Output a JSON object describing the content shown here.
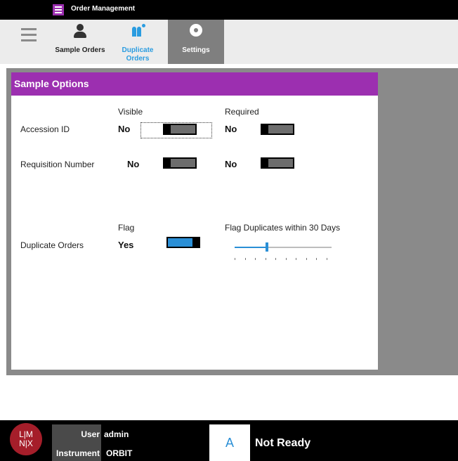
{
  "app": {
    "title": "Order Management"
  },
  "toolbar": {
    "sample_orders": "Sample Orders",
    "duplicate_orders": "Duplicate Orders",
    "settings": "Settings"
  },
  "panel": {
    "title": "Sample Options",
    "col_visible": "Visible",
    "col_required": "Required",
    "rows": [
      {
        "label": "Accession ID",
        "visible": "No",
        "required": "No"
      },
      {
        "label": "Requisition Number",
        "visible": "No",
        "required": "No"
      }
    ],
    "duplicate": {
      "label": "Duplicate Orders",
      "flag_header": "Flag",
      "flag_value": "Yes",
      "slider_label": "Flag Duplicates within 30 Days",
      "slider_fraction": 0.33
    }
  },
  "status": {
    "user_label": "User",
    "user_value": "admin",
    "instrument_label": "Instrument",
    "instrument_value": "ORBIT",
    "state_letter": "A",
    "state_text": "Not Ready"
  },
  "logo": {
    "top": "L|M",
    "bottom": "N|X"
  },
  "colors": {
    "accent": "#9c2fb0",
    "blue": "#2a8fd6",
    "logo": "#a51e2a"
  }
}
